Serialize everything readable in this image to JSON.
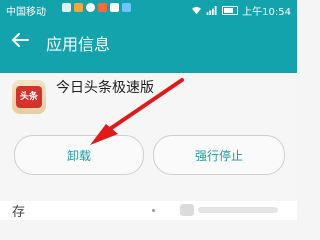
{
  "status_bar": {
    "carrier": "中国移动",
    "time": "上午10:54",
    "battery_text": ""
  },
  "header": {
    "title": "应用信息"
  },
  "app": {
    "name": "今日头条极速版",
    "icon_text": "头条"
  },
  "actions": {
    "uninstall_label": "卸载",
    "force_stop_label": "强行停止"
  },
  "bottom": {
    "label": "存"
  },
  "colors": {
    "header_bg": "#13a3ad",
    "accent_text": "#1e9aa5",
    "arrow": "#e01919"
  }
}
